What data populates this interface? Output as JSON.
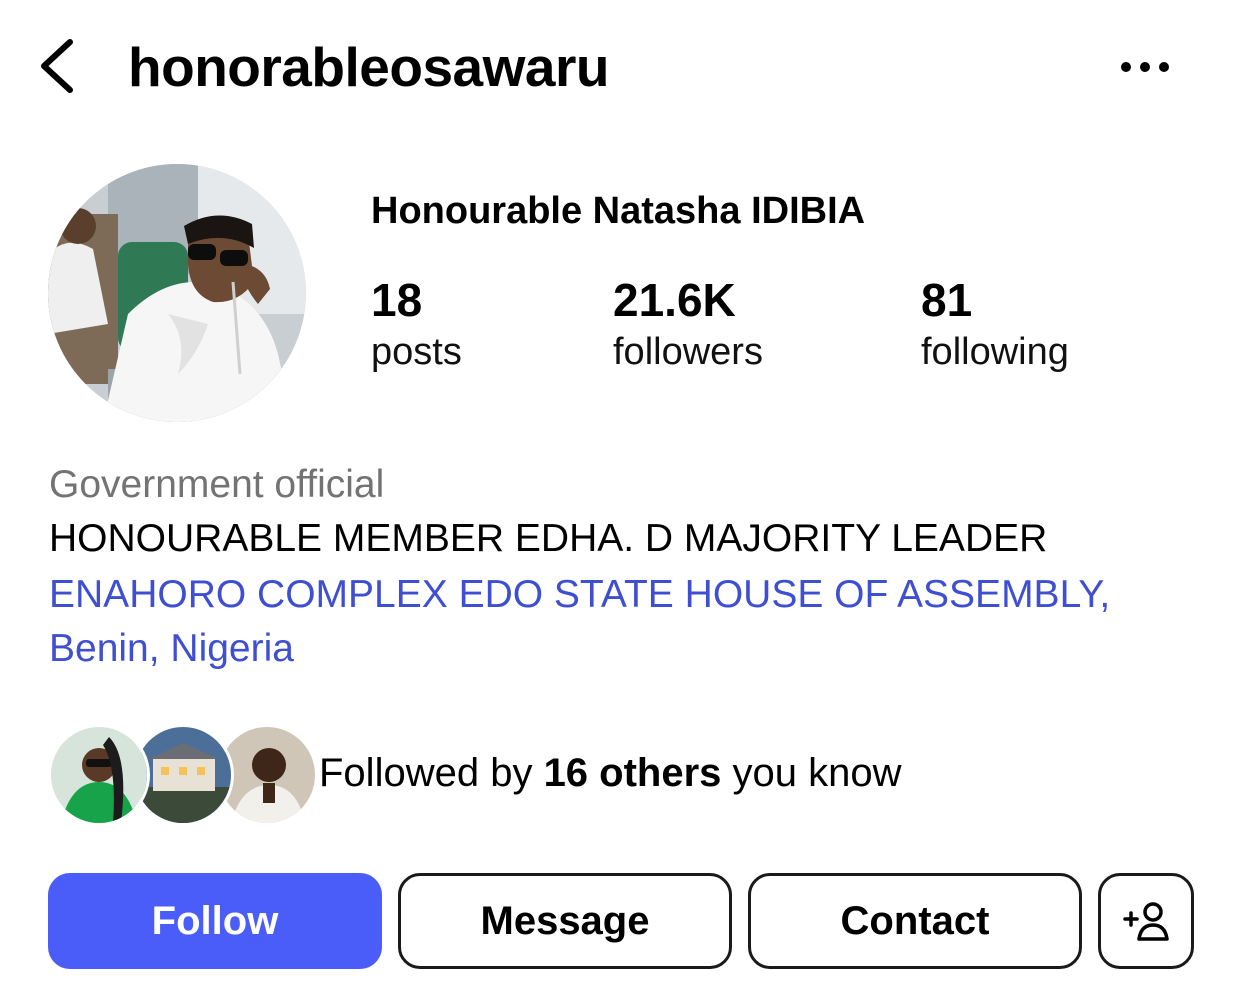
{
  "header": {
    "username": "honorableosawaru"
  },
  "profile": {
    "display_name": "Honourable Natasha IDIBIA",
    "stats": [
      {
        "value": "18",
        "label": "posts"
      },
      {
        "value": "21.6K",
        "label": "followers"
      },
      {
        "value": "81",
        "label": "following"
      }
    ],
    "category": "Government official",
    "bio": "HONOURABLE MEMBER EDHA. D MAJORITY LEADER",
    "address": "ENAHORO COMPLEX EDO STATE HOUSE OF ASSEMBLY, Benin, Nigeria"
  },
  "mutuals": {
    "prefix": "Followed by ",
    "highlight": "16 others",
    "suffix": " you know"
  },
  "actions": {
    "follow": "Follow",
    "message": "Message",
    "contact": "Contact"
  },
  "colors": {
    "accent": "#4a5df9",
    "link": "#3f4fd1",
    "muted": "#737373"
  },
  "icons": [
    "chevron-left-icon",
    "more-horizontal-icon",
    "add-person-icon"
  ]
}
